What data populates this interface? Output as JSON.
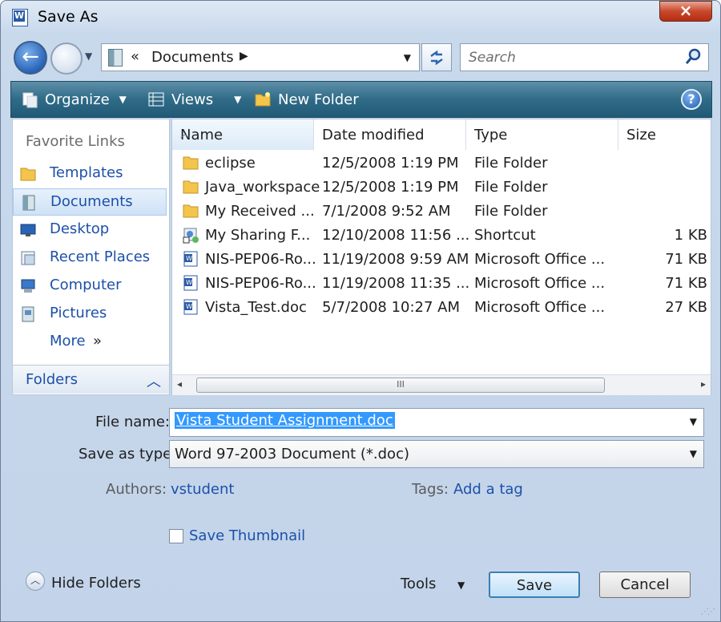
{
  "window": {
    "title": "Save As",
    "close_label": "×"
  },
  "nav_buttons": {
    "back_glyph": "←"
  },
  "address": {
    "chevron": "«",
    "path": "Documents",
    "arrow": "▶",
    "dropdown": "▼"
  },
  "search": {
    "placeholder": "Search"
  },
  "toolbar": {
    "organize": "Organize",
    "views": "Views",
    "new_folder": "New Folder",
    "caret": "▼",
    "help": "?"
  },
  "sidebar": {
    "header": "Favorite Links",
    "items": [
      {
        "label": "Templates",
        "icon": "folder-icon",
        "selected": false
      },
      {
        "label": "Documents",
        "icon": "documents-icon",
        "selected": true
      },
      {
        "label": "Desktop",
        "icon": "desktop-icon",
        "selected": false
      },
      {
        "label": "Recent Places",
        "icon": "recent-places-icon",
        "selected": false
      },
      {
        "label": "Computer",
        "icon": "computer-icon",
        "selected": false
      },
      {
        "label": "Pictures",
        "icon": "pictures-icon",
        "selected": false
      },
      {
        "label": "More",
        "icon": "",
        "selected": false
      }
    ],
    "more_chevron": "»",
    "folders_label": "Folders",
    "folders_caret": "︿"
  },
  "file_list": {
    "columns": [
      "Name",
      "Date modified",
      "Type",
      "Size"
    ],
    "sort_indicator": "︿",
    "rows": [
      {
        "name": "eclipse",
        "date": "12/5/2008 1:19 PM",
        "type": "File Folder",
        "size": "",
        "icon": "folder-icon"
      },
      {
        "name": "Java_workspace",
        "date": "12/5/2008 1:19 PM",
        "type": "File Folder",
        "size": "",
        "icon": "folder-icon"
      },
      {
        "name": "My Received ...",
        "date": "7/1/2008 9:52 AM",
        "type": "File Folder",
        "size": "",
        "icon": "folder-icon"
      },
      {
        "name": "My Sharing F...",
        "date": "12/10/2008 11:56 ...",
        "type": "Shortcut",
        "size": "1 KB",
        "icon": "shortcut-icon"
      },
      {
        "name": "NIS-PEP06-Ro...",
        "date": "11/19/2008 9:59 AM",
        "type": "Microsoft Office ...",
        "size": "71 KB",
        "icon": "word-doc-icon"
      },
      {
        "name": "NIS-PEP06-Ro...",
        "date": "11/19/2008 11:35 ...",
        "type": "Microsoft Office ...",
        "size": "71 KB",
        "icon": "word-doc-icon"
      },
      {
        "name": "Vista_Test.doc",
        "date": "5/7/2008 10:27 AM",
        "type": "Microsoft Office ...",
        "size": "27 KB",
        "icon": "word-doc-icon"
      }
    ],
    "scroll_left": "◂",
    "scroll_right": "▸",
    "scroll_thumb": "III"
  },
  "form": {
    "file_name_label": "File name:",
    "file_name_value": "Vista Student Assignment.doc",
    "save_type_label": "Save as type:",
    "save_type_value": "Word 97-2003 Document (*.doc)",
    "authors_label": "Authors:",
    "authors_value": "vstudent",
    "tags_label": "Tags:",
    "tags_value": "Add a tag",
    "save_thumbnail_label": "Save Thumbnail",
    "save_thumbnail_checked": false
  },
  "footer": {
    "hide_folders": "Hide Folders",
    "hide_caret": "︿",
    "tools": "Tools",
    "save": "Save",
    "cancel": "Cancel"
  },
  "colors": {
    "toolbar": "#2f6b87",
    "link": "#1c50a8",
    "selection": "#3399ff",
    "close": "#c9482c"
  }
}
